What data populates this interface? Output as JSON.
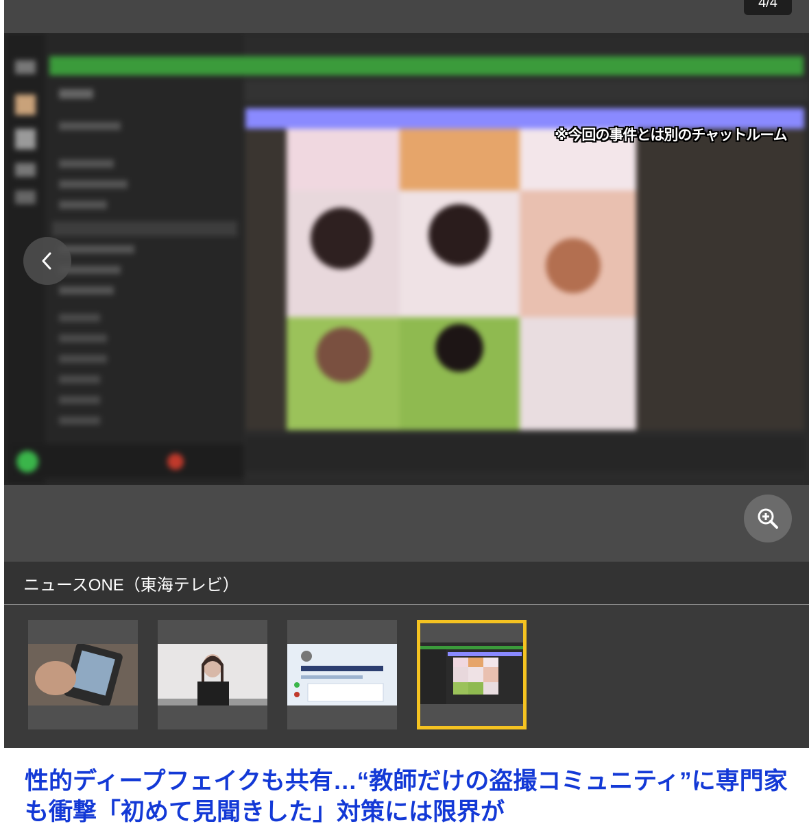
{
  "viewer": {
    "counter": "4/4",
    "overlay_text": "※今回の事件とは別のチャットルーム",
    "caption": "ニュースONE（東海テレビ）",
    "prev_icon": "chevron-left-icon",
    "zoom_icon": "zoom-in-icon",
    "thumbnails": [
      {
        "name": "thumbnail-1",
        "active": false
      },
      {
        "name": "thumbnail-2",
        "active": false
      },
      {
        "name": "thumbnail-3",
        "active": false
      },
      {
        "name": "thumbnail-4",
        "active": true
      }
    ],
    "active_border_color": "#f5c321"
  },
  "article": {
    "headline": "性的ディープフェイクも共有…“教師だけの盗撮コミュニティ”に専門家も衝撃「初めて見聞きした」対策には限界が",
    "headline_color": "#1339d6"
  }
}
